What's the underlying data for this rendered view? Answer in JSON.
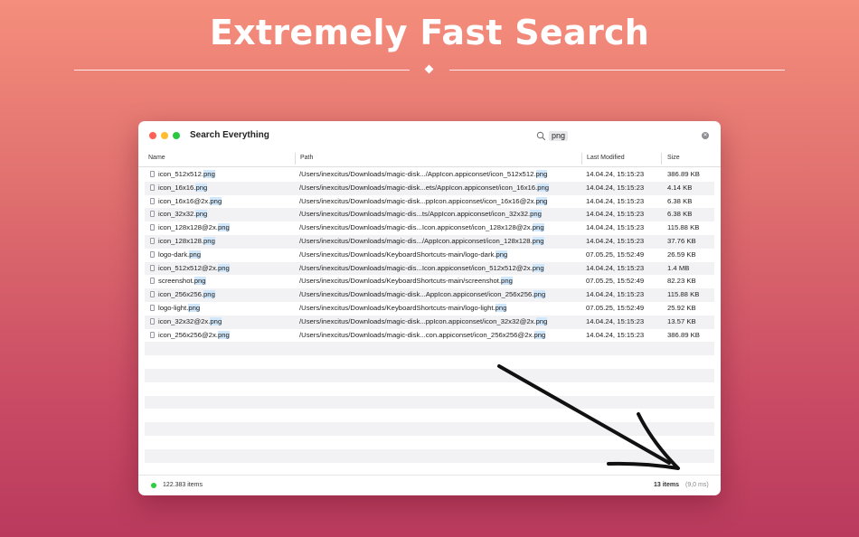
{
  "headline": "Extremely Fast Search",
  "window": {
    "title": "Search Everything",
    "search_query": "png",
    "columns": {
      "name": "Name",
      "path": "Path",
      "modified": "Last Modified",
      "size": "Size"
    },
    "rows": [
      {
        "pre": "icon_512x512.",
        "match": "png",
        "path_pre": "/Users/inexcitus/Downloads/magic-disk.../AppIcon.appiconset/icon_512x512.",
        "path_match": "png",
        "modified": "14.04.24, 15:15:23",
        "size": "386.89 KB"
      },
      {
        "pre": "icon_16x16.",
        "match": "png",
        "path_pre": "/Users/inexcitus/Downloads/magic-disk...ets/AppIcon.appiconset/icon_16x16.",
        "path_match": "png",
        "modified": "14.04.24, 15:15:23",
        "size": "4.14 KB"
      },
      {
        "pre": "icon_16x16@2x.",
        "match": "png",
        "path_pre": "/Users/inexcitus/Downloads/magic-disk...ppIcon.appiconset/icon_16x16@2x.",
        "path_match": "png",
        "modified": "14.04.24, 15:15:23",
        "size": "6.38 KB"
      },
      {
        "pre": "icon_32x32.",
        "match": "png",
        "path_pre": "/Users/inexcitus/Downloads/magic-dis...ts/AppIcon.appiconset/icon_32x32.",
        "path_match": "png",
        "modified": "14.04.24, 15:15:23",
        "size": "6.38 KB"
      },
      {
        "pre": "icon_128x128@2x.",
        "match": "png",
        "path_pre": "/Users/inexcitus/Downloads/magic-dis...Icon.appiconset/icon_128x128@2x.",
        "path_match": "png",
        "modified": "14.04.24, 15:15:23",
        "size": "115.88 KB"
      },
      {
        "pre": "icon_128x128.",
        "match": "png",
        "path_pre": "/Users/inexcitus/Downloads/magic-dis.../AppIcon.appiconset/icon_128x128.",
        "path_match": "png",
        "modified": "14.04.24, 15:15:23",
        "size": "37.76 KB"
      },
      {
        "pre": "logo-dark.",
        "match": "png",
        "path_pre": "/Users/inexcitus/Downloads/KeyboardShortcuts-main/logo-dark.",
        "path_match": "png",
        "modified": "07.05.25, 15:52:49",
        "size": "26.59 KB"
      },
      {
        "pre": "icon_512x512@2x.",
        "match": "png",
        "path_pre": "/Users/inexcitus/Downloads/magic-dis...Icon.appiconset/icon_512x512@2x.",
        "path_match": "png",
        "modified": "14.04.24, 15:15:23",
        "size": "1.4 MB"
      },
      {
        "pre": "screenshot.",
        "match": "png",
        "path_pre": "/Users/inexcitus/Downloads/KeyboardShortcuts-main/screenshot.",
        "path_match": "png",
        "modified": "07.05.25, 15:52:49",
        "size": "82.23 KB"
      },
      {
        "pre": "icon_256x256.",
        "match": "png",
        "path_pre": "/Users/inexcitus/Downloads/magic-disk...AppIcon.appiconset/icon_256x256.",
        "path_match": "png",
        "modified": "14.04.24, 15:15:23",
        "size": "115.88 KB"
      },
      {
        "pre": "logo-light.",
        "match": "png",
        "path_pre": "/Users/inexcitus/Downloads/KeyboardShortcuts-main/logo-light.",
        "path_match": "png",
        "modified": "07.05.25, 15:52:49",
        "size": "25.92 KB"
      },
      {
        "pre": "icon_32x32@2x.",
        "match": "png",
        "path_pre": "/Users/inexcitus/Downloads/magic-disk...ppIcon.appiconset/icon_32x32@2x.",
        "path_match": "png",
        "modified": "14.04.24, 15:15:23",
        "size": "13.57 KB"
      },
      {
        "pre": "icon_256x256@2x.",
        "match": "png",
        "path_pre": "/Users/inexcitus/Downloads/magic-disk...con.appiconset/icon_256x256@2x.",
        "path_match": "png",
        "modified": "14.04.24, 15:15:23",
        "size": "386.89 KB"
      }
    ],
    "footer": {
      "total_items": "122.383 items",
      "result_count": "13 items",
      "timing": "(9,0 ms)"
    }
  },
  "icons": [
    "search-icon",
    "clear-search-icon",
    "file-icon",
    "arrow-annotation-icon"
  ],
  "colors": {
    "highlight": "#d1e7fb",
    "status_dot": "#2ecc40",
    "accent_bg": "#e0706f"
  }
}
